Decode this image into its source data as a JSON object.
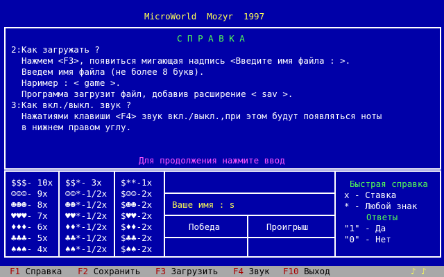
{
  "title": "MicroWorld  Mozyr  1997",
  "help": {
    "heading": "С П Р А В К А",
    "lines": [
      "2:Как загружать ?",
      "  Нажмем <F3>, появиться мигающая надпись <Введите имя файла : >.",
      "  Введем имя файла (не более 8 букв).",
      "  Наример : < game >.",
      "  Программа загрузит файл, добавив расширение < sav >.",
      "3:Как вкл./выкл. звук ?",
      "  Нажатиями клавиши <F4> звук вкл./выкл.,при этом будут появляться ноты",
      "  в нижнем правом углу."
    ],
    "continue": "Для продолжения нажмите ввод"
  },
  "paytable": {
    "col1": [
      "$$$- 10x",
      "☺☺☺- 9x",
      "☻☻☻- 8x",
      "♥♥♥- 7x",
      "♦♦♦- 6x",
      "♣♣♣- 5x",
      "♠♠♠- 4x"
    ],
    "col2": [
      "$$*- 3x",
      "☺☺*-1/2x",
      "☻☻*-1/2x",
      "♥♥*-1/2x",
      "♦♦*-1/2x",
      "♣♣*-1/2x",
      "♠♠*-1/2x"
    ],
    "col3": [
      "$**-1x",
      "$☺☺-2x",
      "$☻☻-2x",
      "$♥♥-2x",
      "$♦♦-2x",
      "$♣♣-2x",
      "$♠♠-2x"
    ]
  },
  "player": {
    "name_label": "Ваше имя : s",
    "win_label": "Победа",
    "lose_label": "Проигрыш"
  },
  "quick_help": {
    "title": "Быстрая справка",
    "lines": [
      "x - Ставка",
      "* - Любой знак"
    ],
    "answers_title": "Ответы",
    "answers": [
      "\"1\" - Да",
      "\"0\" - Нет"
    ]
  },
  "statusbar": {
    "items": [
      {
        "key": "F1",
        "label": "Справка"
      },
      {
        "key": "F2",
        "label": "Сохранить"
      },
      {
        "key": "F3",
        "label": "Загрузить"
      },
      {
        "key": "F4",
        "label": "Звук"
      },
      {
        "key": "F10",
        "label": "Выход"
      }
    ],
    "notes": "♪ ♪"
  }
}
